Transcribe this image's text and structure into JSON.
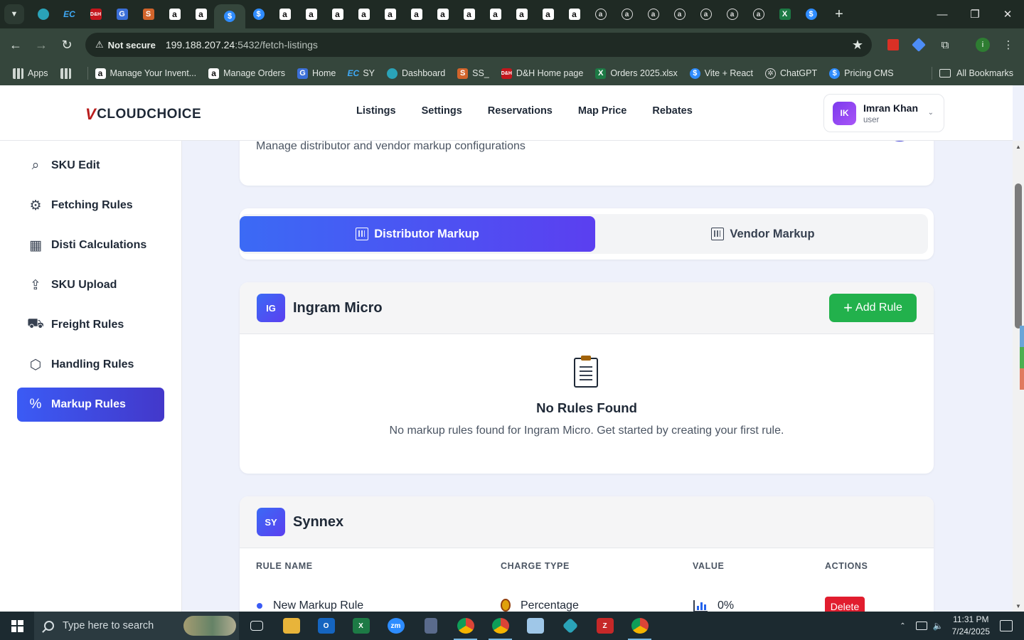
{
  "browser": {
    "tabs": [
      {
        "icon": "chevron-down-icon"
      },
      {
        "icon": "teal-diamond-icon"
      },
      {
        "icon": "ec-icon",
        "glyph": "EC"
      },
      {
        "icon": "dnh-icon",
        "glyph": "D&H"
      },
      {
        "icon": "google-docs-icon",
        "glyph": "G"
      },
      {
        "icon": "stack-icon",
        "glyph": "S"
      },
      {
        "icon": "amazon-icon",
        "glyph": "a"
      },
      {
        "icon": "amazon-icon",
        "glyph": "a"
      },
      {
        "icon": "dollar-icon",
        "glyph": "$",
        "active": true
      },
      {
        "icon": "dollar-icon",
        "glyph": "$"
      },
      {
        "icon": "amazon-icon",
        "glyph": "a"
      },
      {
        "icon": "amazon-icon",
        "glyph": "a"
      },
      {
        "icon": "amazon-icon",
        "glyph": "a"
      },
      {
        "icon": "amazon-icon",
        "glyph": "a"
      },
      {
        "icon": "amazon-icon",
        "glyph": "a"
      },
      {
        "icon": "amazon-icon",
        "glyph": "a"
      },
      {
        "icon": "amazon-icon",
        "glyph": "a"
      },
      {
        "icon": "amazon-icon",
        "glyph": "a"
      },
      {
        "icon": "amazon-icon",
        "glyph": "a"
      },
      {
        "icon": "amazon-icon",
        "glyph": "a"
      },
      {
        "icon": "amazon-icon",
        "glyph": "a"
      },
      {
        "icon": "amazon-icon",
        "glyph": "a"
      },
      {
        "icon": "amazon-circle-icon",
        "glyph": "a"
      },
      {
        "icon": "amazon-circle-icon",
        "glyph": "a"
      },
      {
        "icon": "amazon-circle-icon",
        "glyph": "a"
      },
      {
        "icon": "amazon-circle-icon",
        "glyph": "a"
      },
      {
        "icon": "amazon-circle-icon",
        "glyph": "a"
      },
      {
        "icon": "amazon-circle-icon",
        "glyph": "a"
      },
      {
        "icon": "amazon-circle-icon",
        "glyph": "a"
      },
      {
        "icon": "excel-icon",
        "glyph": "X"
      },
      {
        "icon": "dollar-icon",
        "glyph": "$"
      }
    ],
    "new_tab": "+",
    "security_label": "Not secure",
    "url_host": "199.188.207.24",
    "url_rest": ":5432/fetch-listings",
    "bookmarks": [
      {
        "label": "Apps",
        "icon": "apps-grid-icon"
      },
      {
        "label": "",
        "icon": "tab-groups-icon"
      },
      {
        "label": "Manage Your Invent...",
        "icon": "amazon-icon",
        "glyph": "a"
      },
      {
        "label": "Manage Orders",
        "icon": "amazon-icon",
        "glyph": "a"
      },
      {
        "label": "Home",
        "icon": "google-docs-icon",
        "glyph": "G"
      },
      {
        "label": "SY",
        "icon": "ec-icon",
        "glyph": "EC"
      },
      {
        "label": "Dashboard",
        "icon": "teal-diamond-icon",
        "glyph": ""
      },
      {
        "label": "SS_",
        "icon": "stack-icon",
        "glyph": "S"
      },
      {
        "label": "D&H Home page",
        "icon": "dnh-icon",
        "glyph": "D&H"
      },
      {
        "label": "Orders 2025.xlsx",
        "icon": "excel-icon",
        "glyph": "X"
      },
      {
        "label": "Vite + React",
        "icon": "dollar-icon",
        "glyph": "$"
      },
      {
        "label": "ChatGPT",
        "icon": "chatgpt-icon",
        "glyph": "✲"
      },
      {
        "label": "Pricing CMS",
        "icon": "dollar-icon",
        "glyph": "$"
      }
    ],
    "all_bookmarks": "All Bookmarks"
  },
  "app": {
    "logo_v": "V",
    "logo_text": "CLOUDCHOICE",
    "nav": [
      "Listings",
      "Settings",
      "Reservations",
      "Map Price",
      "Rebates"
    ],
    "user": {
      "initials": "IK",
      "name": "Imran Khan",
      "role": "user"
    }
  },
  "sidebar": {
    "items": [
      {
        "label": "SKU Edit",
        "icon": "search-icon",
        "active": false
      },
      {
        "label": "Fetching Rules",
        "icon": "gear-icon",
        "active": false
      },
      {
        "label": "Disti Calculations",
        "icon": "calculator-icon",
        "active": false
      },
      {
        "label": "SKU Upload",
        "icon": "upload-icon",
        "active": false
      },
      {
        "label": "Freight Rules",
        "icon": "truck-icon",
        "active": false
      },
      {
        "label": "Handling Rules",
        "icon": "box-icon",
        "active": false
      },
      {
        "label": "Markup Rules",
        "icon": "percent-icon",
        "active": true
      }
    ]
  },
  "header": {
    "subtitle": "Manage distributor and vendor markup configurations",
    "badge": "%"
  },
  "toggle": {
    "distributor": "Distributor Markup",
    "vendor": "Vendor Markup"
  },
  "sections": {
    "ingram": {
      "initials": "IG",
      "name": "Ingram Micro",
      "add_button": "Add Rule",
      "empty_title": "No Rules Found",
      "empty_text": "No markup rules found for Ingram Micro. Get started by creating your first rule."
    },
    "synnex": {
      "initials": "SY",
      "name": "Synnex",
      "columns": [
        "RULE NAME",
        "CHARGE TYPE",
        "VALUE",
        "ACTIONS"
      ],
      "rows": [
        {
          "name": "New Markup Rule",
          "charge_type": "Percentage",
          "value": "0%",
          "action": "Delete"
        }
      ]
    }
  },
  "taskbar": {
    "search_placeholder": "Type here to search",
    "time": "11:31 PM",
    "date": "7/24/2025"
  },
  "colors": {
    "accent": "#3b5bf5",
    "accent_purple": "#5b3ff0",
    "success": "#22b14c",
    "danger": "#e11d2e"
  }
}
